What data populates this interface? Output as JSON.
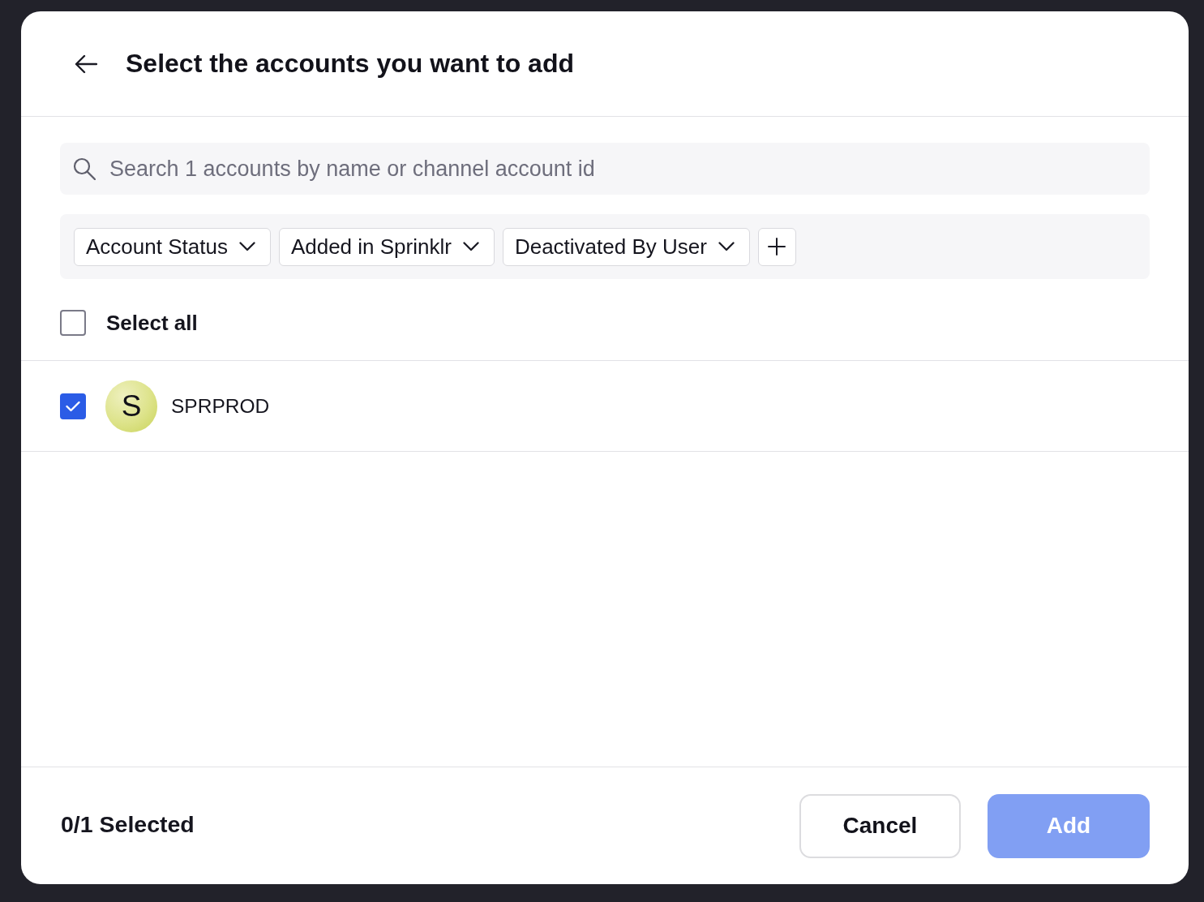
{
  "header": {
    "title": "Select the accounts you want to add"
  },
  "search": {
    "placeholder": "Search 1 accounts by name or channel account id"
  },
  "filters": [
    {
      "label": "Account Status"
    },
    {
      "label": "Added in Sprinklr"
    },
    {
      "label": "Deactivated By User"
    }
  ],
  "select_all": {
    "label": "Select all",
    "checked": false
  },
  "accounts": [
    {
      "initial": "S",
      "name": "SPRPROD",
      "selected": true
    }
  ],
  "footer": {
    "selection_count": "0/1 Selected",
    "buttons": [
      {
        "label": "Cancel",
        "kind": "secondary",
        "disabled": false
      },
      {
        "label": "Add",
        "kind": "primary",
        "disabled": true
      }
    ]
  }
}
